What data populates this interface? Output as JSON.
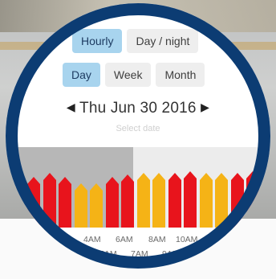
{
  "view_toggle": {
    "items": [
      "Hourly",
      "Day / night"
    ],
    "active": 0
  },
  "period_toggle": {
    "items": [
      "Day",
      "Week",
      "Month"
    ],
    "active": 0
  },
  "date": {
    "prev_icon": "chevron-left-icon",
    "label": "Thu Jun 30 2016",
    "next_icon": "chevron-right-icon",
    "hint": "Select date"
  },
  "colors": {
    "ring": "#0c3c73",
    "active_button": "#a8d4ee",
    "bar_red": "#e8141c",
    "bar_orange": "#f5b316"
  },
  "chart_data": {
    "type": "bar",
    "bars": [
      {
        "level": 0.68,
        "tier": "red"
      },
      {
        "level": 0.74,
        "tier": "red"
      },
      {
        "level": 0.68,
        "tier": "red"
      },
      {
        "level": 0.6,
        "tier": "orange"
      },
      {
        "level": 0.6,
        "tier": "orange"
      },
      {
        "level": 0.68,
        "tier": "red"
      },
      {
        "level": 0.72,
        "tier": "red"
      },
      {
        "level": 0.74,
        "tier": "orange"
      },
      {
        "level": 0.74,
        "tier": "orange"
      },
      {
        "level": 0.74,
        "tier": "red"
      },
      {
        "level": 0.76,
        "tier": "red"
      },
      {
        "level": 0.74,
        "tier": "orange"
      },
      {
        "level": 0.74,
        "tier": "orange"
      },
      {
        "level": 0.74,
        "tier": "red"
      },
      {
        "level": 0.76,
        "tier": "red"
      }
    ],
    "x_ticks_row1": [
      "M",
      "4AM",
      "6AM",
      "8AM",
      "10AM",
      "1"
    ],
    "x_ticks_row2": [
      "5AM",
      "7AM",
      "9AM"
    ]
  }
}
